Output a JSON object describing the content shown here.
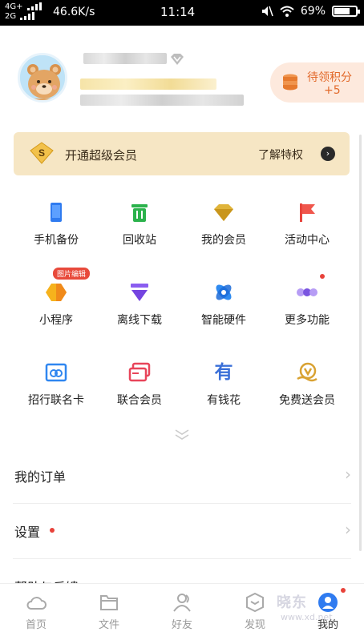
{
  "status_bar": {
    "network_top": "4G+",
    "network_bottom": "2G",
    "speed": "46.6K/s",
    "time": "11:14",
    "battery": "69%"
  },
  "profile": {
    "points_label": "待领积分",
    "points_value": "+5"
  },
  "vip_banner": {
    "title": "开通超级会员",
    "link": "了解特权",
    "icon_letter": "S"
  },
  "features": [
    {
      "label": "手机备份",
      "icon": "phone-backup-icon"
    },
    {
      "label": "回收站",
      "icon": "recycle-bin-icon"
    },
    {
      "label": "我的会员",
      "icon": "diamond-icon"
    },
    {
      "label": "活动中心",
      "icon": "flag-icon"
    },
    {
      "label": "小程序",
      "icon": "mini-program-icon",
      "badge": "图片编辑"
    },
    {
      "label": "离线下载",
      "icon": "download-icon"
    },
    {
      "label": "智能硬件",
      "icon": "smart-hardware-icon"
    },
    {
      "label": "更多功能",
      "icon": "more-icon"
    },
    {
      "label": "招行联名卡",
      "icon": "bank-card-icon"
    },
    {
      "label": "联合会员",
      "icon": "joint-card-icon"
    },
    {
      "label": "有钱花",
      "icon": "youqianhua-icon",
      "icon_char": "有"
    },
    {
      "label": "免费送会员",
      "icon": "free-vip-icon"
    }
  ],
  "list": [
    {
      "label": "我的订单"
    },
    {
      "label": "设置"
    },
    {
      "label": "帮助与反馈"
    }
  ],
  "tabs": [
    {
      "label": "首页",
      "icon": "cloud-icon"
    },
    {
      "label": "文件",
      "icon": "folder-icon"
    },
    {
      "label": "好友",
      "icon": "friends-icon"
    },
    {
      "label": "发现",
      "icon": "discover-icon"
    },
    {
      "label": "我的",
      "icon": "me-icon",
      "active": true
    }
  ],
  "colors": {
    "vip_bg": "#f6e6c4",
    "points_bg": "#fde9dd",
    "accent_orange": "#e2692a",
    "red_dot": "#e8423a",
    "active_tab": "#2f7bf0"
  },
  "watermark": {
    "text": "晓东",
    "site": "www.xd.net"
  }
}
